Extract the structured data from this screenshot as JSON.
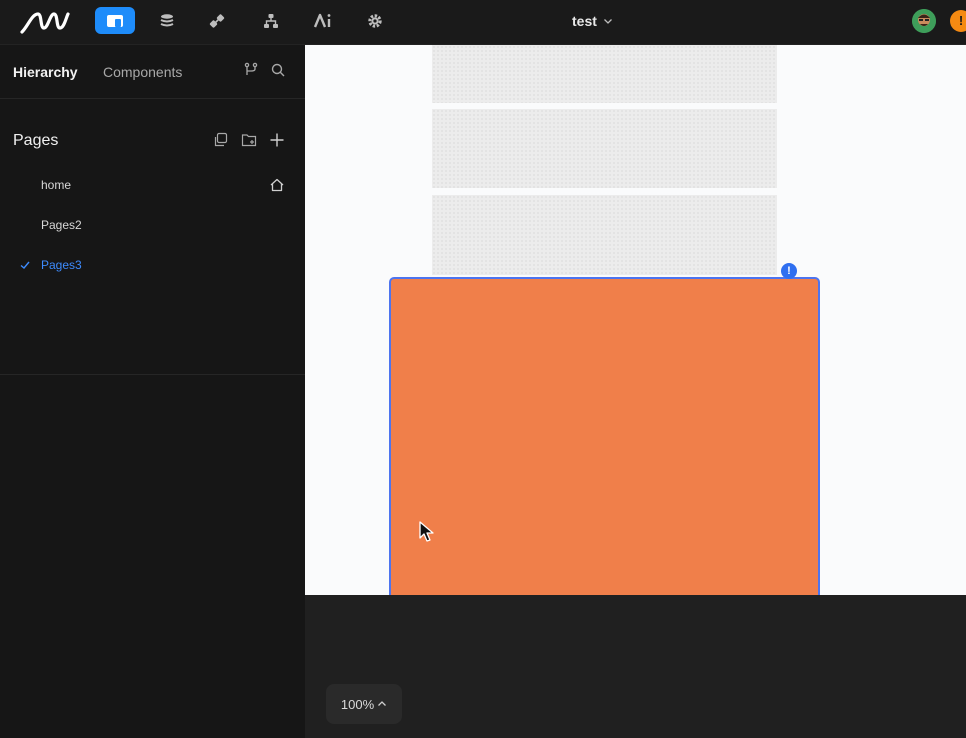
{
  "app": {
    "title": "test",
    "logo": "m-logo",
    "nav": [
      {
        "name": "pages-nav-icon",
        "active": true
      },
      {
        "name": "database-icon",
        "active": false
      },
      {
        "name": "api-plug-icon",
        "active": false
      },
      {
        "name": "workflow-icon",
        "active": false
      },
      {
        "name": "ai-icon",
        "active": false
      },
      {
        "name": "settings-gear-icon",
        "active": false
      }
    ],
    "warning_badge": "!"
  },
  "sidebar": {
    "tabs": [
      "Hierarchy",
      "Components"
    ],
    "pages_heading": "Pages",
    "pages": [
      {
        "label": "home",
        "is_home": true,
        "selected": false
      },
      {
        "label": "Pages2",
        "is_home": false,
        "selected": false
      },
      {
        "label": "Pages3",
        "is_home": false,
        "selected": true
      }
    ]
  },
  "canvas": {
    "selection_badge": "!",
    "selected_fill": "#f07f4a",
    "selection_color": "#4d74ef"
  },
  "zoom": {
    "label": "100%"
  },
  "colors": {
    "accent": "#1e8cfa",
    "selected_text": "#3d8bfd",
    "warning": "#f58a12"
  }
}
